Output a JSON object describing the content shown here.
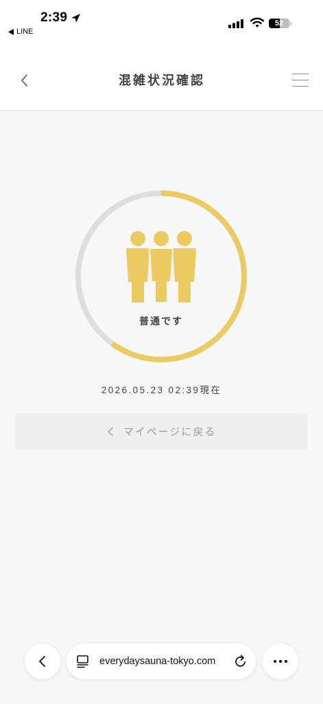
{
  "status_bar": {
    "time": "2:39",
    "back_app_label": "LINE",
    "battery_level": "52",
    "icons": [
      "location-arrow-icon",
      "back-triangle-icon",
      "signal-icon",
      "wifi-icon",
      "battery-icon"
    ]
  },
  "header": {
    "title": "混雑状況確認",
    "back_icon": "chevron-left-icon",
    "menu_icon": "hamburger-menu-icon"
  },
  "crowd_status": {
    "label": "普通です",
    "level": 0.6,
    "icon": "people-icon",
    "updated_at": "2026.05.23 02:39現在"
  },
  "mypage_button": {
    "label": "マイページに戻る",
    "icon": "chevron-left-icon"
  },
  "browser_toolbar": {
    "url": "everydaysauna-tokyo.com",
    "icons": [
      "browser-back-icon",
      "page-menu-icon",
      "reload-icon",
      "more-icon"
    ]
  },
  "colors": {
    "accent": "#EBCB61",
    "track": "#DDDDDD",
    "page_background": "#F7F7F7",
    "header_background": "#FFFFFF",
    "text": "#3A3A3A",
    "button_background": "#EFEFEF",
    "button_text": "#9A9A9A"
  }
}
